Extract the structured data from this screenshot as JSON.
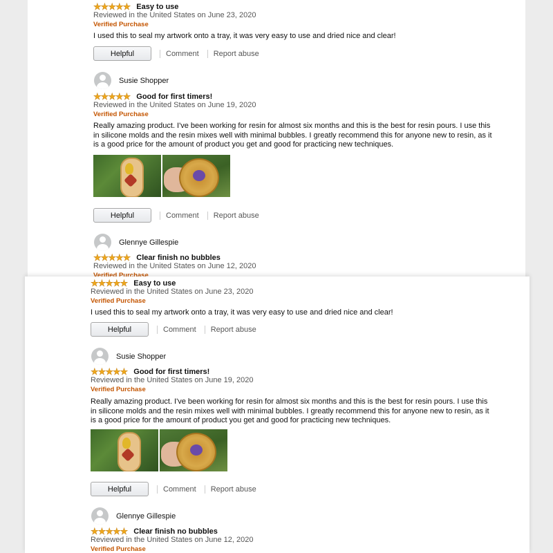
{
  "stars_color": "#f0a81a",
  "verified_color": "#c45500",
  "reviews": [
    {
      "rating": 5,
      "title": "Easy to use",
      "date": "Reviewed in the United States on June 23, 2020",
      "verified": "Verified Purchase",
      "text": "I used this to seal my artwork onto a tray, it was very easy to use and dried nice and clear!",
      "helpful": "Helpful",
      "comment": "Comment",
      "report": "Report abuse"
    },
    {
      "author": "Susie Shopper",
      "rating": 5,
      "title": "Good for first timers!",
      "date": "Reviewed in the United States on June 19, 2020",
      "verified": "Verified Purchase",
      "text": "Really amazing product. I've been working for resin for almost six months and this is the best for resin pours. I use this in silicone molds and the resin mixes well with minimal bubbles. I greatly recommend this for anyone new to resin, as it is a good price for the amount of product you get and good for practicing new techniques.",
      "helpful": "Helpful",
      "comment": "Comment",
      "report": "Report abuse"
    },
    {
      "author": "Glennye Gillespie",
      "rating": 5,
      "title": "Clear finish no bubbles",
      "date": "Reviewed in the United States on June 12, 2020",
      "verified": "Verified Purchase"
    }
  ]
}
